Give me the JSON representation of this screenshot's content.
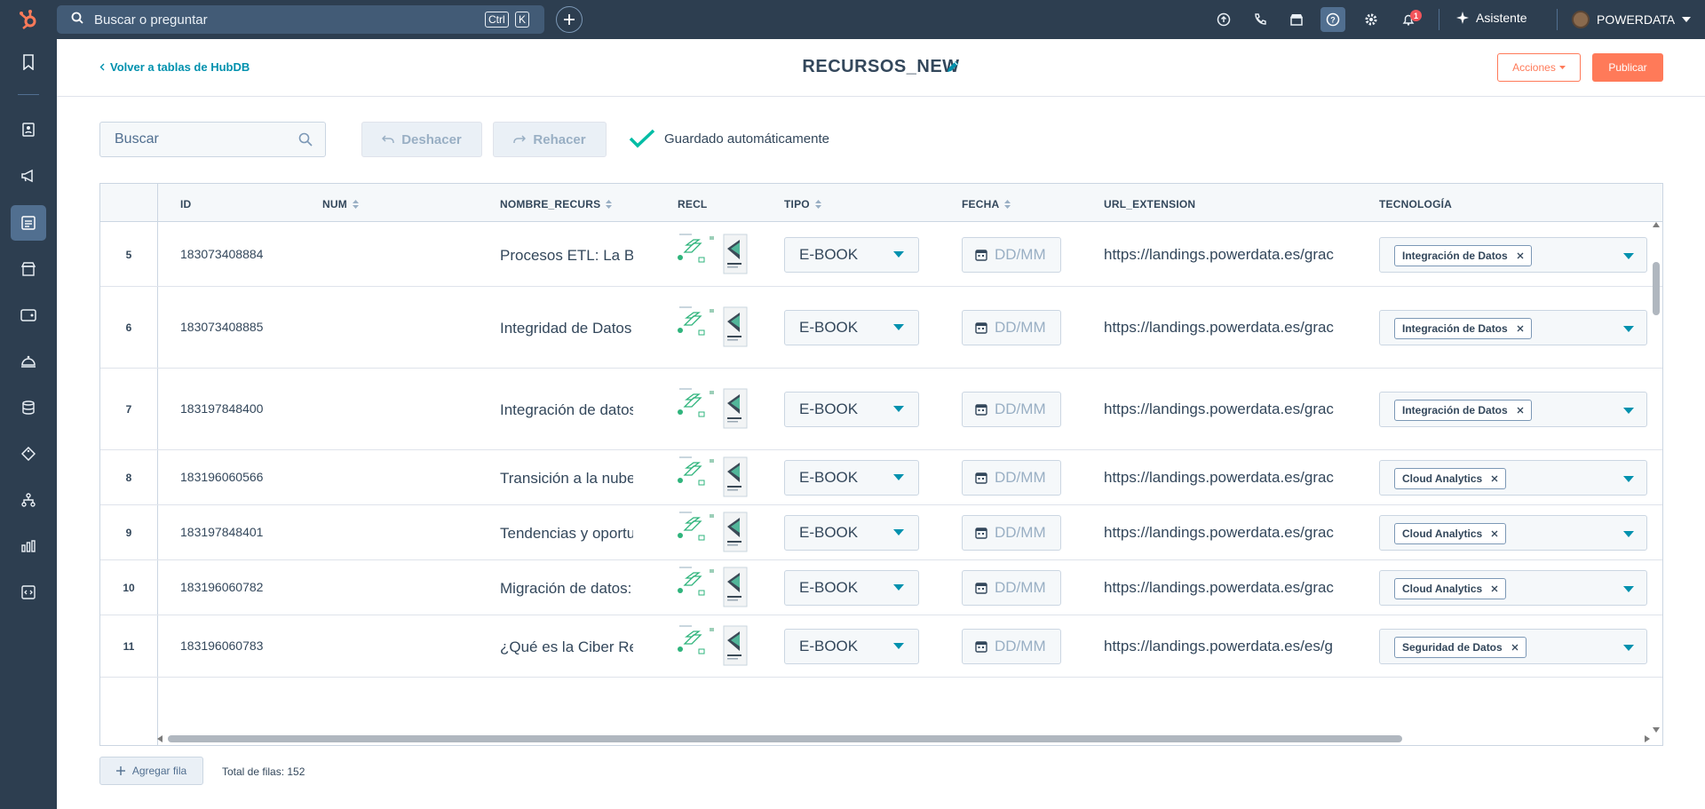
{
  "topbar": {
    "search_placeholder": "Buscar o preguntar",
    "kbd_ctrl": "Ctrl",
    "kbd_k": "K",
    "notification_count": "1",
    "assistant_label": "Asistente",
    "account_name": "POWERDATA"
  },
  "header": {
    "back_label": "Volver a tablas de HubDB",
    "title": "RECURSOS_NEW",
    "actions_label": "Acciones",
    "publish_label": "Publicar"
  },
  "toolbar": {
    "search_placeholder": "Buscar",
    "undo_label": "Deshacer",
    "redo_label": "Rehacer",
    "saved_label": "Guardado automáticamente"
  },
  "table": {
    "columns": {
      "id": "ID",
      "num": "NUM",
      "nombre": "NOMBRE_RECURS",
      "recu": "RECL",
      "tipo": "TIPO",
      "fecha": "FECHA",
      "url": "URL_EXTENSION",
      "tecnologia": "TECNOLOGÍA"
    },
    "date_placeholder": "DD/MM",
    "rows": [
      {
        "num": "5",
        "id": "183073408884",
        "nombre": "Procesos ETL: La Ba",
        "tipo": "E-BOOK",
        "url": "https://landings.powerdata.es/grac",
        "tag": "Integración de Datos"
      },
      {
        "num": "6",
        "id": "183073408885",
        "nombre": "Integridad de Datos",
        "tipo": "E-BOOK",
        "url": "https://landings.powerdata.es/grac",
        "tag": "Integración de Datos"
      },
      {
        "num": "7",
        "id": "183197848400",
        "nombre": "Integración de datos",
        "tipo": "E-BOOK",
        "url": "https://landings.powerdata.es/grac",
        "tag": "Integración de Datos"
      },
      {
        "num": "8",
        "id": "183196060566",
        "nombre": "Transición a la nube:",
        "tipo": "E-BOOK",
        "url": "https://landings.powerdata.es/grac",
        "tag": "Cloud Analytics"
      },
      {
        "num": "9",
        "id": "183197848401",
        "nombre": "Tendencias y oportu",
        "tipo": "E-BOOK",
        "url": "https://landings.powerdata.es/grac",
        "tag": "Cloud Analytics"
      },
      {
        "num": "10",
        "id": "183196060782",
        "nombre": "Migración de datos:",
        "tipo": "E-BOOK",
        "url": "https://landings.powerdata.es/grac",
        "tag": "Cloud Analytics"
      },
      {
        "num": "11",
        "id": "183196060783",
        "nombre": "¿Qué es la Ciber Res",
        "tipo": "E-BOOK",
        "url": "https://landings.powerdata.es/es/g",
        "tag": "Seguridad de Datos"
      }
    ]
  },
  "footer": {
    "add_row_label": "Agregar fila",
    "total_rows_label": "Total de filas: 152"
  },
  "colors": {
    "nav_bg": "#2d3e50",
    "accent": "#ff7a59",
    "link": "#0091ae"
  }
}
